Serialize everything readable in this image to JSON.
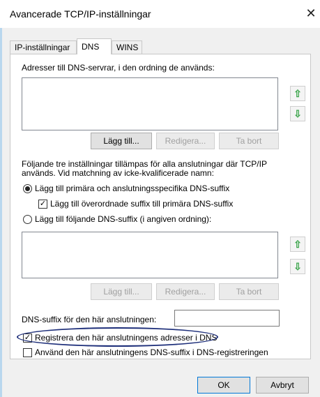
{
  "window": {
    "title": "Avancerade TCP/IP-inställningar",
    "close_glyph": "✕"
  },
  "tabs": [
    {
      "label": "IP-inställningar",
      "active": false
    },
    {
      "label": "DNS",
      "active": true
    },
    {
      "label": "WINS",
      "active": false
    }
  ],
  "dns_servers": {
    "label": "Adresser till DNS-servrar, i den ordning de används:",
    "items": [],
    "buttons": {
      "add": "Lägg till...",
      "edit": "Redigera...",
      "remove": "Ta bort"
    }
  },
  "info_text_line1": "Följande tre inställningar tillämpas för alla anslutningar där TCP/IP",
  "info_text_line2": "används. Vid matchning av icke-kvalificerade namn:",
  "options": {
    "primary_radio": "Lägg till primära och anslutningsspecifika DNS-suffix",
    "parent_suffix_check": "Lägg till överordnade suffix till primära DNS-suffix",
    "suffix_radio": "Lägg till följande DNS-suffix (i angiven ordning):"
  },
  "suffix_list": {
    "items": [],
    "buttons": {
      "add": "Lägg till...",
      "edit": "Redigera...",
      "remove": "Ta bort"
    }
  },
  "connection_suffix": {
    "label": "DNS-suffix för den här anslutningen:",
    "value": ""
  },
  "register": {
    "register_label": "Registrera den här anslutningens adresser i DNS",
    "use_suffix_label": "Använd den här anslutningens DNS-suffix i DNS-registreringen"
  },
  "footer": {
    "ok": "OK",
    "cancel": "Avbryt"
  },
  "colors": {
    "arrow": "#3aa44a",
    "highlight_ellipse": "#1e2f7a",
    "accent": "#0078d7"
  },
  "icons": {
    "up_arrow": "⇧",
    "down_arrow": "⇩"
  }
}
